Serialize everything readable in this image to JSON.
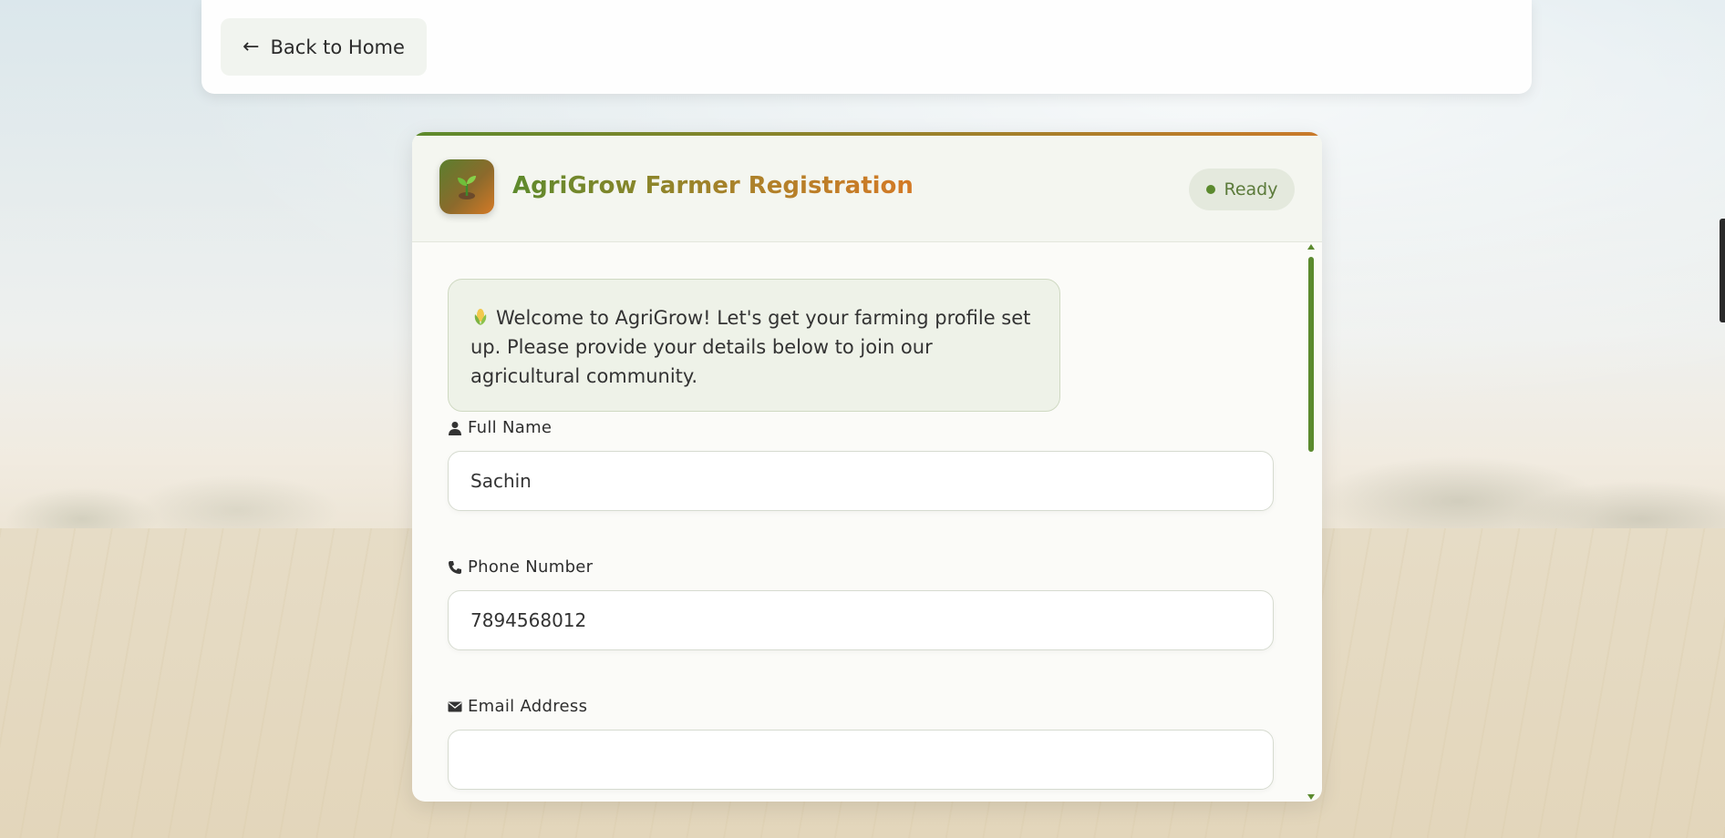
{
  "nav": {
    "back_label": "Back to Home",
    "back_icon": "arrow-left-icon"
  },
  "header": {
    "title": "AgriGrow Farmer Registration",
    "logo_icon": "seedling-icon",
    "status_label": "Ready",
    "status_color": "#5b8a2e"
  },
  "welcome": {
    "icon": "corn-icon",
    "message": "Welcome to AgriGrow! Let's get your farming profile set up. Please provide your details below to join our agricultural community."
  },
  "form": {
    "full_name": {
      "label": "Full Name",
      "icon": "user-icon",
      "value": "Sachin"
    },
    "phone": {
      "label": "Phone Number",
      "icon": "phone-icon",
      "value": "7894568012"
    },
    "email": {
      "label": "Email Address",
      "icon": "envelope-icon",
      "value": ""
    }
  },
  "colors": {
    "accent_green": "#5d8a2c",
    "accent_orange": "#d47a26"
  }
}
